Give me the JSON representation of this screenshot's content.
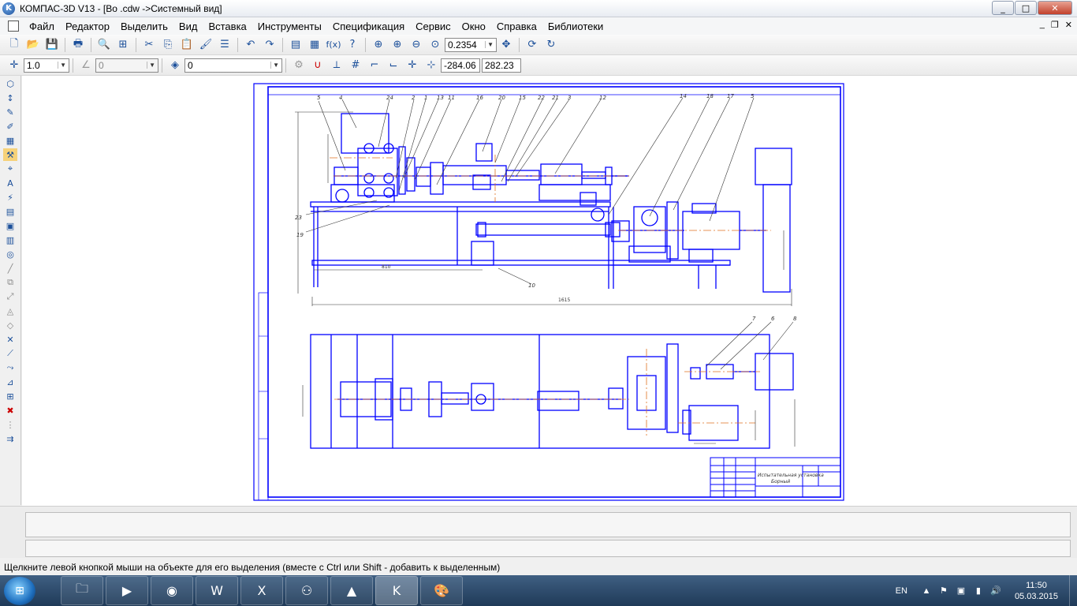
{
  "window": {
    "title": "КОМПАС-3D V13 - [Во .cdw ->Системный вид]",
    "minimize": "_",
    "maximize": "□",
    "close": "✕"
  },
  "menu": {
    "items": [
      "Файл",
      "Редактор",
      "Выделить",
      "Вид",
      "Вставка",
      "Инструменты",
      "Спецификация",
      "Сервис",
      "Окно",
      "Справка",
      "Библиотеки"
    ],
    "doc_controls": [
      "_",
      "❐",
      "✕"
    ]
  },
  "toolbar1": {
    "zoom_value": "0.2354"
  },
  "toolbar2": {
    "step_value": "1.0",
    "angle_value": "0",
    "layer_value": "0",
    "coord_x": "-284.06",
    "coord_y": "282.23"
  },
  "drawing": {
    "top_labels": [
      "5",
      "4",
      "24",
      "2",
      "1",
      "13",
      "11",
      "16",
      "20",
      "15",
      "22",
      "21",
      "3",
      "12",
      "14",
      "18",
      "17",
      "5"
    ],
    "side_labels": [
      "23",
      "19"
    ],
    "bottom_labels": [
      "10"
    ],
    "plan_labels": [
      "7",
      "6",
      "8"
    ],
    "dim_top": "1615",
    "dim_left": "810",
    "stamp_title_1": "Испытательная установка",
    "stamp_title_2": "Борный"
  },
  "status": {
    "text": "Щелкните левой кнопкой мыши на объекте для его выделения (вместе с Ctrl или Shift - добавить к выделенным)"
  },
  "taskbar": {
    "apps": [
      "explorer-icon",
      "ie-icon",
      "media-icon",
      "firefox-icon",
      "word-icon",
      "excel-icon",
      "network-icon",
      "vlc-icon",
      "kompas-icon",
      "paint-icon"
    ],
    "lang": "EN",
    "time": "11:50",
    "date": "05.03.2015"
  }
}
